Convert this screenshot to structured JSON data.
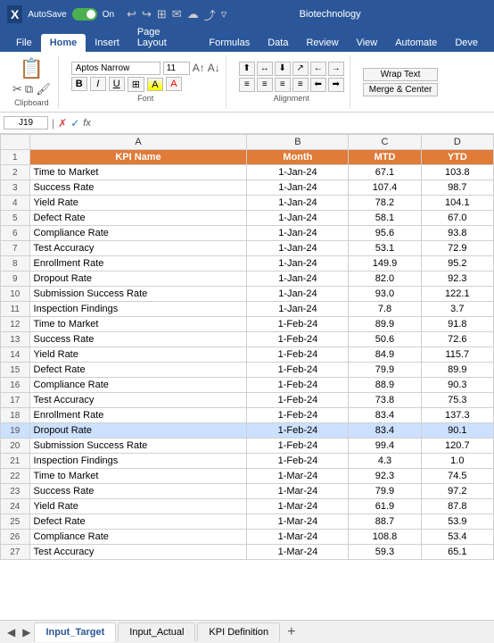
{
  "titleBar": {
    "excelIcon": "X",
    "autoSaveLabel": "AutoSave",
    "autoSaveState": "On",
    "title": "Biotechnology",
    "icons": [
      "↩",
      "↪",
      "⊞",
      "✉",
      "☁",
      "🔔",
      "⚙",
      "⛶",
      "▿"
    ]
  },
  "ribbonTabs": [
    "File",
    "Home",
    "Insert",
    "Page Layout",
    "Formulas",
    "Data",
    "Review",
    "View",
    "Automate",
    "Deve"
  ],
  "activeTab": "Home",
  "fontGroup": {
    "fontName": "Aptos Narrow",
    "fontSize": "11",
    "label": "Font"
  },
  "alignmentLabel": "Alignment",
  "clipboardLabel": "Clipboard",
  "cellRef": "J19",
  "formulaBar": {
    "checkIcon": "✓",
    "crossIcon": "✗",
    "fxLabel": "fx",
    "value": ""
  },
  "columns": {
    "rowNum": "#",
    "a": "A",
    "b": "B",
    "c": "C",
    "d": "D"
  },
  "headers": {
    "a": "KPI Name",
    "b": "Month",
    "c": "MTD",
    "d": "YTD"
  },
  "rows": [
    {
      "num": 2,
      "kpi": "Time to Market",
      "month": "1-Jan-24",
      "mtd": "67.1",
      "ytd": "103.8"
    },
    {
      "num": 3,
      "kpi": "Success Rate",
      "month": "1-Jan-24",
      "mtd": "107.4",
      "ytd": "98.7"
    },
    {
      "num": 4,
      "kpi": "Yield Rate",
      "month": "1-Jan-24",
      "mtd": "78.2",
      "ytd": "104.1"
    },
    {
      "num": 5,
      "kpi": "Defect Rate",
      "month": "1-Jan-24",
      "mtd": "58.1",
      "ytd": "67.0"
    },
    {
      "num": 6,
      "kpi": "Compliance Rate",
      "month": "1-Jan-24",
      "mtd": "95.6",
      "ytd": "93.8"
    },
    {
      "num": 7,
      "kpi": "Test Accuracy",
      "month": "1-Jan-24",
      "mtd": "53.1",
      "ytd": "72.9"
    },
    {
      "num": 8,
      "kpi": "Enrollment Rate",
      "month": "1-Jan-24",
      "mtd": "149.9",
      "ytd": "95.2"
    },
    {
      "num": 9,
      "kpi": "Dropout Rate",
      "month": "1-Jan-24",
      "mtd": "82.0",
      "ytd": "92.3"
    },
    {
      "num": 10,
      "kpi": "Submission Success Rate",
      "month": "1-Jan-24",
      "mtd": "93.0",
      "ytd": "122.1"
    },
    {
      "num": 11,
      "kpi": "Inspection Findings",
      "month": "1-Jan-24",
      "mtd": "7.8",
      "ytd": "3.7"
    },
    {
      "num": 12,
      "kpi": "Time to Market",
      "month": "1-Feb-24",
      "mtd": "89.9",
      "ytd": "91.8"
    },
    {
      "num": 13,
      "kpi": "Success Rate",
      "month": "1-Feb-24",
      "mtd": "50.6",
      "ytd": "72.6"
    },
    {
      "num": 14,
      "kpi": "Yield Rate",
      "month": "1-Feb-24",
      "mtd": "84.9",
      "ytd": "115.7"
    },
    {
      "num": 15,
      "kpi": "Defect Rate",
      "month": "1-Feb-24",
      "mtd": "79.9",
      "ytd": "89.9"
    },
    {
      "num": 16,
      "kpi": "Compliance Rate",
      "month": "1-Feb-24",
      "mtd": "88.9",
      "ytd": "90.3"
    },
    {
      "num": 17,
      "kpi": "Test Accuracy",
      "month": "1-Feb-24",
      "mtd": "73.8",
      "ytd": "75.3"
    },
    {
      "num": 18,
      "kpi": "Enrollment Rate",
      "month": "1-Feb-24",
      "mtd": "83.4",
      "ytd": "137.3"
    },
    {
      "num": 19,
      "kpi": "Dropout Rate",
      "month": "1-Feb-24",
      "mtd": "83.4",
      "ytd": "90.1"
    },
    {
      "num": 20,
      "kpi": "Submission Success Rate",
      "month": "1-Feb-24",
      "mtd": "99.4",
      "ytd": "120.7"
    },
    {
      "num": 21,
      "kpi": "Inspection Findings",
      "month": "1-Feb-24",
      "mtd": "4.3",
      "ytd": "1.0"
    },
    {
      "num": 22,
      "kpi": "Time to Market",
      "month": "1-Mar-24",
      "mtd": "92.3",
      "ytd": "74.5"
    },
    {
      "num": 23,
      "kpi": "Success Rate",
      "month": "1-Mar-24",
      "mtd": "79.9",
      "ytd": "97.2"
    },
    {
      "num": 24,
      "kpi": "Yield Rate",
      "month": "1-Mar-24",
      "mtd": "61.9",
      "ytd": "87.8"
    },
    {
      "num": 25,
      "kpi": "Defect Rate",
      "month": "1-Mar-24",
      "mtd": "88.7",
      "ytd": "53.9"
    },
    {
      "num": 26,
      "kpi": "Compliance Rate",
      "month": "1-Mar-24",
      "mtd": "108.8",
      "ytd": "53.4"
    },
    {
      "num": 27,
      "kpi": "Test Accuracy",
      "month": "1-Mar-24",
      "mtd": "59.3",
      "ytd": "65.1"
    }
  ],
  "sheetTabs": [
    {
      "label": "Input_Target",
      "active": true
    },
    {
      "label": "Input_Actual",
      "active": false
    },
    {
      "label": "KPI Definition",
      "active": false
    }
  ],
  "addSheet": "+",
  "wrapText": "Wrap Text",
  "mergeCenter": "Merge & Center"
}
